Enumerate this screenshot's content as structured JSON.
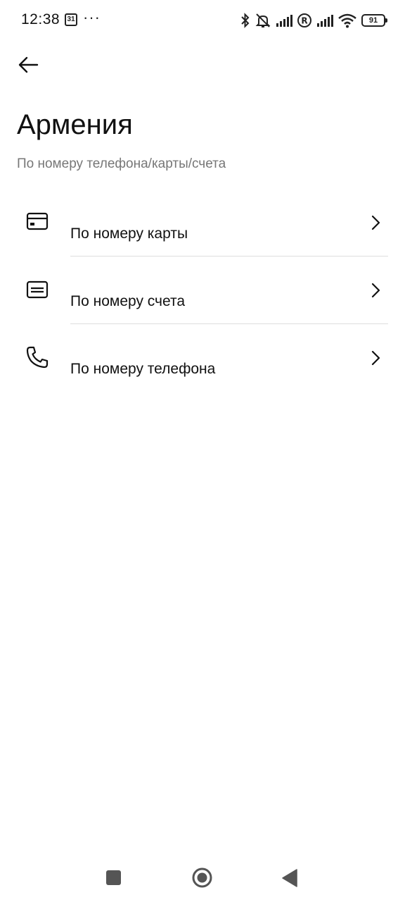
{
  "status_bar": {
    "time": "12:38",
    "calendar_day": "31",
    "more": "···",
    "battery_level": "91",
    "icons": [
      "bluetooth-icon",
      "muted-vibrate-icon",
      "signal-icon",
      "roaming-icon",
      "signal-icon",
      "wifi-icon",
      "battery-icon"
    ]
  },
  "header": {
    "back_icon": "arrow-left-icon",
    "title": "Армения",
    "subtitle": "По номеру телефона/карты/счета"
  },
  "options": [
    {
      "label": "По номеру карты",
      "icon": "credit-card-icon"
    },
    {
      "label": "По номеру счета",
      "icon": "account-card-icon"
    },
    {
      "label": "По номеру телефона",
      "icon": "phone-icon"
    }
  ],
  "nav_bar": {
    "icons": [
      "recents-square-icon",
      "home-circle-icon",
      "back-triangle-icon"
    ]
  },
  "colors": {
    "text_primary": "#111111",
    "text_secondary": "#777777",
    "divider": "#dddddd",
    "background": "#ffffff"
  }
}
